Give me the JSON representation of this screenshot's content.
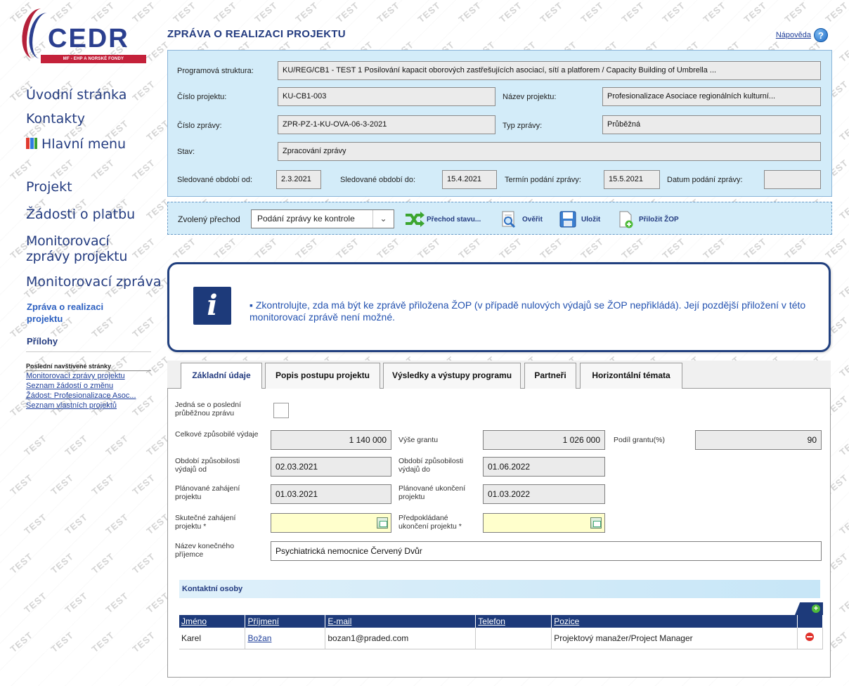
{
  "watermark": "TEST",
  "logo": {
    "text": "CEDR",
    "subtitle": "MF - EHP A NORSKÉ FONDY"
  },
  "sidebar": {
    "top_links": [
      "Úvodní stránka",
      "Kontakty",
      "Hlavní menu"
    ],
    "section_links": [
      "Projekt",
      "Žádosti o platbu",
      "Monitorovací zprávy projektu",
      "Monitorovací zpráva"
    ],
    "sub_links": [
      "Zpráva o realizaci projektu",
      "Přílohy"
    ],
    "recent_title": "Poslední navštívené stránky",
    "recent_links": [
      "Monitorovací zprávy projektu",
      "Seznam žádostí o změnu",
      "Žádost: Profesionalizace Asoc...",
      "Seznam vlastních projektů"
    ]
  },
  "header": {
    "title": "ZPRÁVA O REALIZACI PROJEKTU",
    "help_label": "Nápověda"
  },
  "info": {
    "program_label": "Programová struktura:",
    "program_value": "KU/REG/CB1 - TEST 1 Posilování kapacit oborových zastřešujících asociací, sítí a platforem / Capacity Building of Umbrella ...",
    "project_no_label": "Číslo projektu:",
    "project_no": "KU-CB1-003",
    "project_name_label": "Název projektu:",
    "project_name": "Profesionalizace Asociace regionálních kulturní...",
    "report_no_label": "Číslo zprávy:",
    "report_no": "ZPR-PZ-1-KU-OVA-06-3-2021",
    "report_type_label": "Typ zprávy:",
    "report_type": "Průběžná",
    "state_label": "Stav:",
    "state": "Zpracování zprávy",
    "period_from_label": "Sledované období od:",
    "period_from": "2.3.2021",
    "period_to_label": "Sledované období do:",
    "period_to": "15.4.2021",
    "deadline_label": "Termín podání zprávy:",
    "deadline": "15.5.2021",
    "submitted_label": "Datum podání zprávy:",
    "submitted": ""
  },
  "toolbar": {
    "transition_label": "Zvolený přechod",
    "transition_value": "Podání zprávy ke kontrole",
    "btn_transition": "Přechod stavu...",
    "btn_verify": "Ověřit",
    "btn_save": "Uložit",
    "btn_attach": "Přiložit ŽOP"
  },
  "alert": {
    "text": "Zkontrolujte, zda má být ke zprávě přiložena ŽOP (v případě nulových výdajů se ŽOP nepřikládá). Její pozdější přiložení v této monitorovací zprávě není možné."
  },
  "tabs": [
    "Základní údaje",
    "Popis postupu projektu",
    "Výsledky a výstupy programu",
    "Partneři",
    "Horizontální témata"
  ],
  "form": {
    "last_report_label": "Jedná se o poslední průběžnou zprávu",
    "total_costs_label": "Celkové způsobilé výdaje",
    "total_costs": "1 140 000",
    "grant_label": "Výše grantu",
    "grant": "1 026 000",
    "grant_share_label": "Podíl grantu(%)",
    "grant_share": "90",
    "eligible_from_label": "Období způsobilosti výdajů od",
    "eligible_from": "02.03.2021",
    "eligible_to_label": "Období způsobilosti výdajů do",
    "eligible_to": "01.06.2022",
    "planned_start_label": "Plánované zahájení projektu",
    "planned_start": "01.03.2021",
    "planned_end_label": "Plánované ukončení projektu",
    "planned_end": "01.03.2022",
    "actual_start_label": "Skutečné zahájení projektu *",
    "expected_end_label": "Předpokládané ukončení projektu *",
    "recipient_label": "Název konečného příjemce",
    "recipient": "Psychiatrická nemocnice Červený Dvůr"
  },
  "contacts": {
    "title": "Kontaktní osoby",
    "columns": [
      "Jméno",
      "Příjmení",
      "E-mail",
      "Telefon",
      "Pozice"
    ],
    "rows": [
      {
        "first": "Karel",
        "last": "Božan",
        "email": "bozan1@praded.com",
        "phone": "",
        "position": "Projektový manažer/Project Manager"
      }
    ]
  },
  "colors": {
    "navy": "#243c80",
    "panel": "#d3ecf9",
    "required": "#ffffcc",
    "alert_border": "#21407f"
  }
}
